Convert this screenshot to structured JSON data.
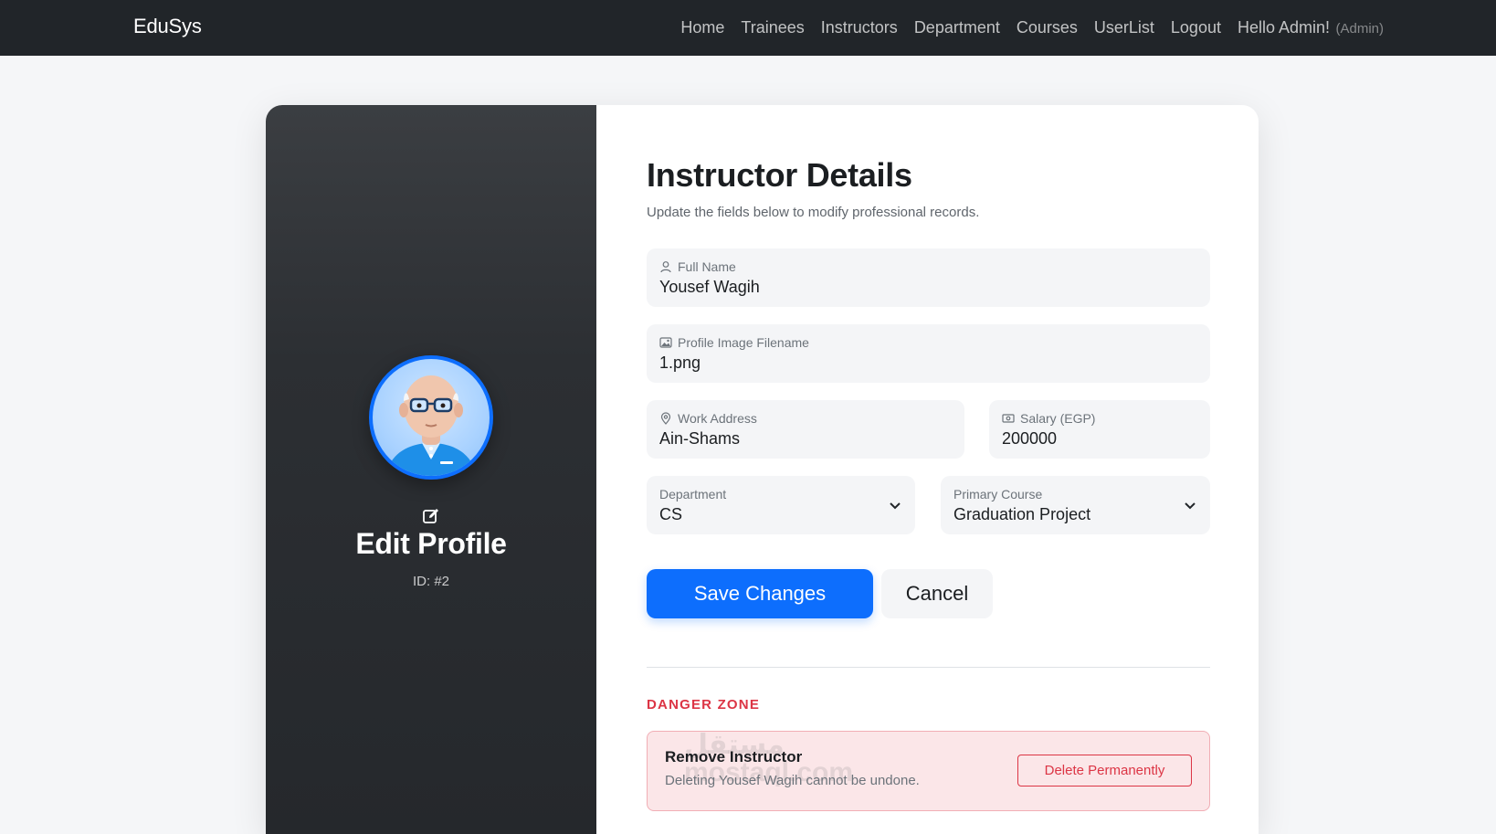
{
  "navbar": {
    "brand": "EduSys",
    "links": [
      "Home",
      "Trainees",
      "Instructors",
      "Department",
      "Courses",
      "UserList",
      "Logout"
    ],
    "greeting": "Hello Admin!",
    "role": "(Admin)"
  },
  "sidebar": {
    "title": "Edit Profile",
    "id_text": "ID: #2",
    "avatar_icon": "avatar-3d-bald-man-glasses",
    "edit_icon": "edit-icon"
  },
  "form": {
    "heading": "Instructor Details",
    "subheading": "Update the fields below to modify professional records.",
    "full_name": {
      "label": "Full Name",
      "value": "Yousef Wagih",
      "icon": "person-icon"
    },
    "image": {
      "label": "Profile Image Filename",
      "value": "1.png",
      "icon": "image-icon"
    },
    "address": {
      "label": "Work Address",
      "value": "Ain-Shams",
      "icon": "location-icon"
    },
    "salary": {
      "label": "Salary (EGP)",
      "value": "200000",
      "icon": "cash-icon"
    },
    "department": {
      "label": "Department",
      "value": "CS"
    },
    "course": {
      "label": "Primary Course",
      "value": "Graduation Project"
    },
    "save_label": "Save Changes",
    "cancel_label": "Cancel"
  },
  "danger": {
    "section_title": "DANGER ZONE",
    "title": "Remove Instructor",
    "text": "Deleting Yousef Wagih cannot be undone.",
    "button": "Delete Permanently",
    "watermark_top": "مستقل",
    "watermark_bottom": "mostaql.com"
  },
  "colors": {
    "primary": "#0d6efd",
    "danger": "#dc3545",
    "navbar": "#212529"
  }
}
